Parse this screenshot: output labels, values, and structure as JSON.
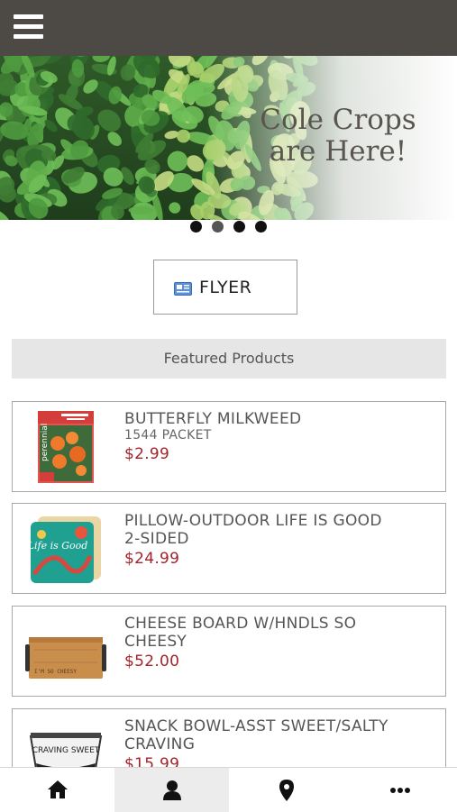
{
  "header": {
    "menu_icon": "hamburger-menu-icon"
  },
  "hero": {
    "headline_line1": "Cole Crops",
    "headline_line2": "are Here!",
    "slides": 4,
    "active_slide": 2
  },
  "flyer": {
    "label": "FLYER",
    "icon": "newspaper-icon"
  },
  "featured": {
    "title": "Featured Products"
  },
  "products": [
    {
      "name": "BUTTERFLY MILKWEED",
      "sub": "1544 PACKET",
      "price": "$2.99",
      "thumb_text": "perennial"
    },
    {
      "name": "PILLOW-OUTDOOR LIFE IS GOOD 2-SIDED",
      "sub": "",
      "price": "$24.99",
      "thumb_text": "Life is Good"
    },
    {
      "name": "CHEESE BOARD W/HNDLS SO CHEESY",
      "sub": "",
      "price": "$52.00",
      "thumb_text": "I'M SO CHEESY"
    },
    {
      "name": "SNACK BOWL-ASST SWEET/SALTY CRAVING",
      "sub": "",
      "price": "$15.99",
      "thumb_text": "CRAVING SWEET"
    }
  ],
  "bottom_nav": [
    {
      "icon": "home-icon",
      "selected": false
    },
    {
      "icon": "user-icon",
      "selected": true
    },
    {
      "icon": "map-pin-icon",
      "selected": false
    },
    {
      "icon": "more-icon",
      "selected": false
    }
  ],
  "colors": {
    "topbar": "#4d4944",
    "price": "#a3232a",
    "featured_bg": "#e6e6e6",
    "nav_selected_bg": "#ececec"
  }
}
